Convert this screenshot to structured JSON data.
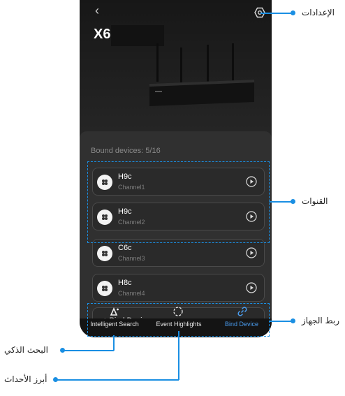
{
  "app": {
    "title": "X6",
    "back_glyph": "‹"
  },
  "hub": {
    "bound_devices": "Bound devices: 5/16"
  },
  "devices": [
    {
      "name": "H9c",
      "channel": "Channel1"
    },
    {
      "name": "H9c",
      "channel": "Channel2"
    },
    {
      "name": "C6c",
      "channel": "Channel3"
    },
    {
      "name": "H8c",
      "channel": "Channel4"
    }
  ],
  "bind": {
    "label": "+ Bind Device",
    "arrow": "›"
  },
  "tabs": [
    {
      "label": "Intelligent Search",
      "icon": "intelligent-search-icon"
    },
    {
      "label": "Event Highlights",
      "icon": "event-highlights-icon"
    },
    {
      "label": "Bind Device",
      "icon": "link-icon",
      "active": true
    }
  ],
  "annotations": {
    "settings": "الإعدادات",
    "channels": "القنوات",
    "bind_device": "ربط الجهاز",
    "intelligent_search": "البحث الذكي",
    "event_highlights": "أبرز الأحداث"
  },
  "colors": {
    "accent": "#1a8fe3",
    "active_tab": "#4a9df0",
    "background": "#1b1b1b"
  }
}
